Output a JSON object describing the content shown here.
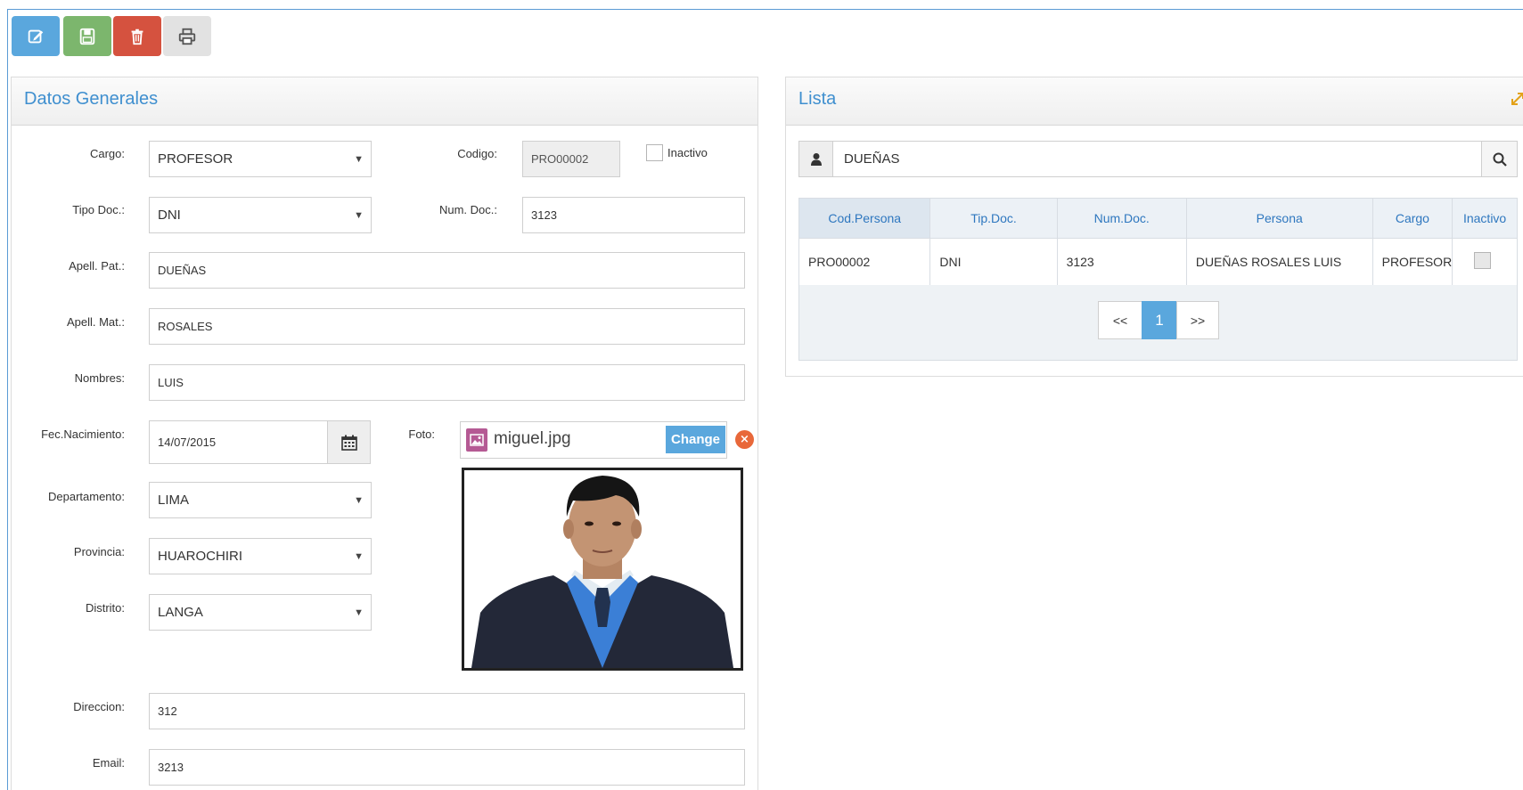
{
  "colors": {
    "accent": "#5aa7dd",
    "success": "#7cb66d",
    "danger": "#d5523f",
    "title": "#3f8fcf",
    "header_text": "#2e77bf"
  },
  "toolbar": {
    "edit_icon": "edit-icon",
    "save_icon": "save-icon",
    "delete_icon": "trash-icon",
    "print_icon": "print-icon"
  },
  "form": {
    "title": "Datos Generales",
    "cargo": {
      "label": "Cargo:",
      "value": "PROFESOR"
    },
    "codigo": {
      "label": "Codigo:",
      "value": "PRO00002"
    },
    "inactivo": {
      "label": "Inactivo",
      "checked": false
    },
    "tipo_doc": {
      "label": "Tipo Doc.:",
      "value": "DNI"
    },
    "num_doc": {
      "label": "Num. Doc.:",
      "value": "3123"
    },
    "apell_pat": {
      "label": "Apell. Pat.:",
      "value": "DUEÑAS"
    },
    "apell_mat": {
      "label": "Apell. Mat.:",
      "value": "ROSALES"
    },
    "nombres": {
      "label": "Nombres:",
      "value": "LUIS"
    },
    "fec_nacimiento": {
      "label": "Fec.Nacimiento:",
      "value": "14/07/2015"
    },
    "foto": {
      "label": "Foto:",
      "file_name": "miguel.jpg",
      "change_label": "Change",
      "remove_label": "×"
    },
    "departamento": {
      "label": "Departamento:",
      "value": "LIMA"
    },
    "provincia": {
      "label": "Provincia:",
      "value": "HUAROCHIRI"
    },
    "distrito": {
      "label": "Distrito:",
      "value": "LANGA"
    },
    "direccion": {
      "label": "Direccion:",
      "value": "312"
    },
    "email": {
      "label": "Email:",
      "value": "3213"
    }
  },
  "list": {
    "title": "Lista",
    "search_value": "DUEÑAS",
    "columns": [
      "Cod.Persona",
      "Tip.Doc.",
      "Num.Doc.",
      "Persona",
      "Cargo",
      "Inactivo"
    ],
    "rows": [
      {
        "cod_persona": "PRO00002",
        "tip_doc": "DNI",
        "num_doc": "3123",
        "persona": "DUEÑAS ROSALES LUIS",
        "cargo": "PROFESOR",
        "inactivo": false
      }
    ],
    "pagination": {
      "prev": "<<",
      "current": "1",
      "next": ">>"
    }
  }
}
